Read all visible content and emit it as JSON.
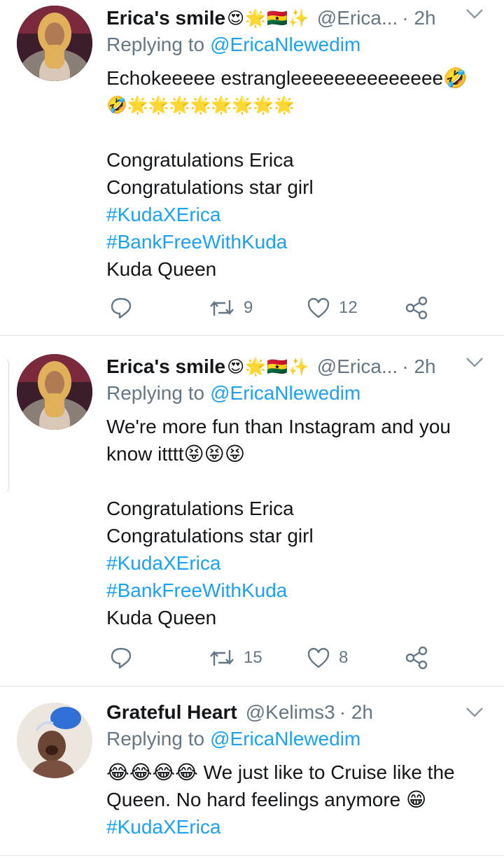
{
  "colors": {
    "link": "#1da1f2",
    "muted": "#657786",
    "text": "#14171a",
    "divider": "#e1e8ed"
  },
  "tweets": [
    {
      "display_name": "Erica's smile",
      "name_emojis": "😍🌟🇬🇭✨",
      "handle": "@Erica...",
      "time": "· 2h",
      "replying_label": "Replying to",
      "replying_to": "@EricaNlewedim",
      "body_line1": "Echokeeeee estrangleeeeeeeeeeeeee🤣",
      "body_line2": "🤣🌟🌟🌟🌟🌟🌟🌟🌟",
      "body_line3": "Congratulations Erica",
      "body_line4": "Congratulations star girl",
      "hashtag1": "#KudaXErica",
      "hashtag2": "#BankFreeWithKuda",
      "body_last": "Kuda Queen",
      "retweets": "9",
      "likes": "12",
      "avatar_icon": "woman-portrait-avatar"
    },
    {
      "display_name": "Erica's smile",
      "name_emojis": "😍🌟🇬🇭✨",
      "handle": "@Erica...",
      "time": "· 2h",
      "replying_label": "Replying to",
      "replying_to": "@EricaNlewedim",
      "body_line1": "We're more fun than Instagram and you",
      "body_line2": "know itttt😝😝😝",
      "body_line3": "Congratulations Erica",
      "body_line4": "Congratulations star girl",
      "hashtag1": "#KudaXErica",
      "hashtag2": "#BankFreeWithKuda",
      "body_last": "Kuda Queen",
      "retweets": "15",
      "likes": "8",
      "avatar_icon": "woman-portrait-avatar"
    },
    {
      "display_name": "Grateful Heart",
      "name_emojis": "",
      "handle": "@Kelims3",
      "time": "· 2h",
      "replying_label": "Replying to",
      "replying_to": "@EricaNlewedim",
      "body_line1": "😂😂😂😂 We just like to Cruise like the",
      "body_line2": "Queen. No hard feelings anymore 😁",
      "hashtag1": "#KudaXErica",
      "avatar_icon": "child-splash-avatar"
    }
  ]
}
